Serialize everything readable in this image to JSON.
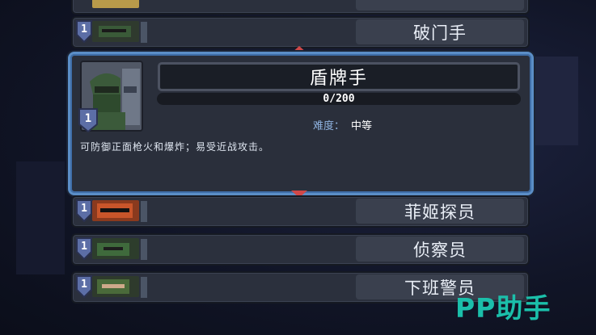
{
  "list": {
    "items": [
      {
        "name": "破门手",
        "level": "1",
        "portrait_color": "#3a5a38"
      },
      {
        "name": "菲姬探员",
        "level": "1",
        "portrait_color": "#c8552a"
      },
      {
        "name": "侦察员",
        "level": "1",
        "portrait_color": "#3f6a3c"
      },
      {
        "name": "下班警员",
        "level": "1",
        "portrait_color": "#4a6a3a"
      }
    ]
  },
  "selected": {
    "name": "盾牌手",
    "level": "1",
    "progress_text": "0/200",
    "progress_fraction": 0,
    "difficulty_label": "难度：",
    "difficulty_value": "中等",
    "description": "可防御正面枪火和爆炸；易受近战攻击。"
  },
  "watermark": "PP助手",
  "colors": {
    "accent_border": "#5b8ec7",
    "arrow": "#d04848",
    "watermark": "#1bbfaa",
    "progress": "#6aa84f"
  }
}
